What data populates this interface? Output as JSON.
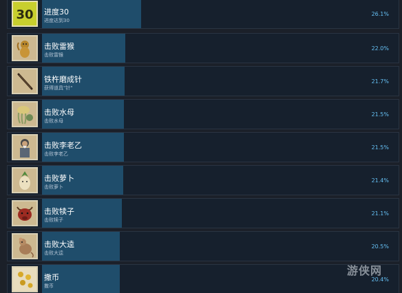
{
  "achievements": [
    {
      "title": "进度30",
      "desc": "进度达到30",
      "pct": "26.1%",
      "progress": 0.261,
      "icon": "number-30-icon"
    },
    {
      "title": "击败雷猴",
      "desc": "击败雷猴",
      "pct": "22.0%",
      "progress": 0.22,
      "icon": "monkey-icon"
    },
    {
      "title": "铁杵磨成针",
      "desc": "获得道具\"针\"",
      "pct": "21.7%",
      "progress": 0.217,
      "icon": "needle-icon"
    },
    {
      "title": "击败水母",
      "desc": "击败水母",
      "pct": "21.5%",
      "progress": 0.215,
      "icon": "jellyfish-icon"
    },
    {
      "title": "击败李老乙",
      "desc": "击败李老乙",
      "pct": "21.5%",
      "progress": 0.215,
      "icon": "old-man-icon"
    },
    {
      "title": "击败萝卜",
      "desc": "击败萝卜",
      "pct": "21.4%",
      "progress": 0.214,
      "icon": "radish-icon"
    },
    {
      "title": "击败犊子",
      "desc": "击败犊子",
      "pct": "21.1%",
      "progress": 0.211,
      "icon": "bull-icon"
    },
    {
      "title": "击败大逵",
      "desc": "击败大逵",
      "pct": "20.5%",
      "progress": 0.205,
      "icon": "rat-icon"
    },
    {
      "title": "撒币",
      "desc": "撒币",
      "pct": "20.4%",
      "progress": 0.204,
      "icon": "coins-icon"
    }
  ],
  "watermark": "游侠网"
}
